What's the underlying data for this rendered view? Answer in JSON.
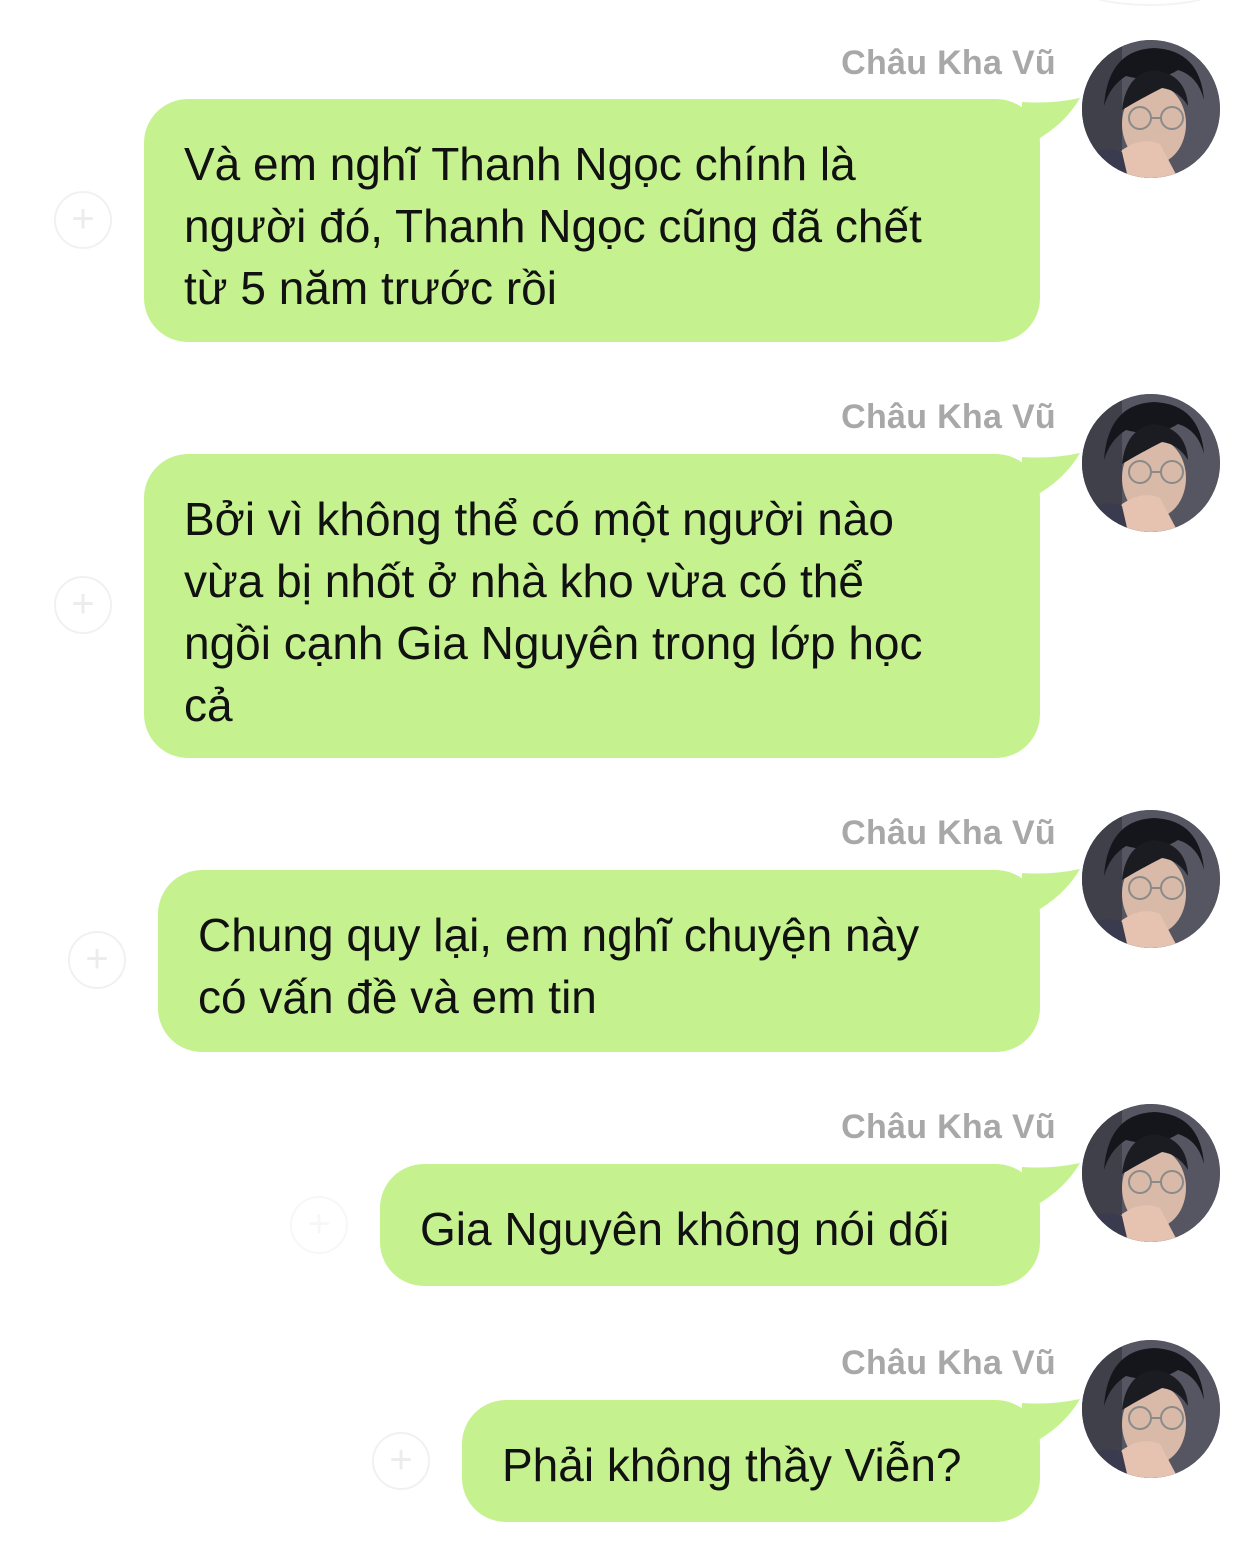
{
  "sender_name": "Châu Kha Vũ",
  "plus_symbol": "+",
  "colors": {
    "bubble": "#c5f28f",
    "sender": "#a8a8a8",
    "background": "#ffffff",
    "text": "#111111"
  },
  "messages": [
    {
      "sender": "Châu Kha Vũ",
      "text": "Và em nghĩ Thanh Ngọc chính là\nngười đó, Thanh Ngọc cũng đã chết\ntừ 5 năm trước rồi"
    },
    {
      "sender": "Châu Kha Vũ",
      "text": "Bởi vì không thể có một người nào\nvừa bị nhốt ở nhà kho vừa có thể\nngồi cạnh Gia Nguyên trong lớp học\ncả"
    },
    {
      "sender": "Châu Kha Vũ",
      "text": "Chung quy lại, em nghĩ chuyện này\ncó vấn đề và em tin"
    },
    {
      "sender": "Châu Kha Vũ",
      "text": "Gia Nguyên không nói dối"
    },
    {
      "sender": "Châu Kha Vũ",
      "text": "Phải không thầy Viễn?"
    }
  ],
  "icons": {
    "avatar": "avatar-photo-icon",
    "add": "plus-circle-icon"
  }
}
